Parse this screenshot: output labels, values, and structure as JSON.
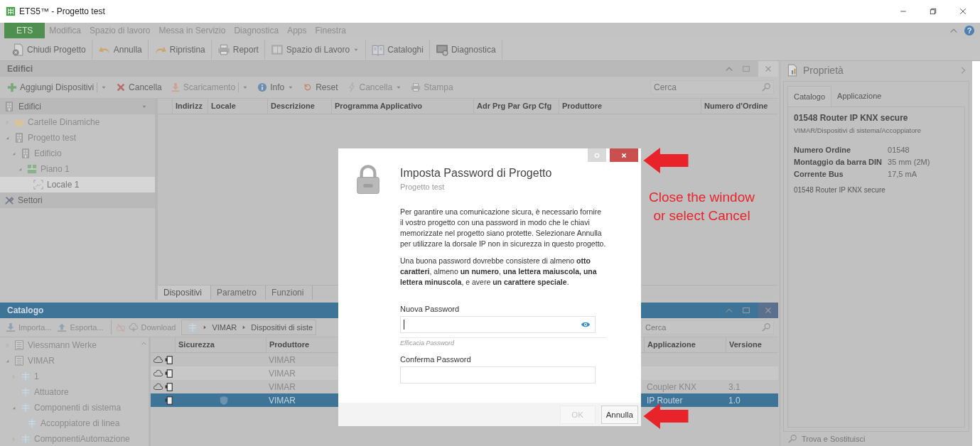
{
  "window": {
    "title": "ETS5™ - Progetto test"
  },
  "menu": [
    {
      "label": "ETS",
      "selected": true
    },
    {
      "label": "Modifica",
      "selected": false
    },
    {
      "label": "Spazio di lavoro",
      "selected": false
    },
    {
      "label": "Messa in Servizio",
      "selected": false
    },
    {
      "label": "Diagnostica",
      "selected": false
    },
    {
      "label": "Apps",
      "selected": false
    },
    {
      "label": "Finestra",
      "selected": false
    }
  ],
  "help": "?",
  "toolbar": [
    {
      "label": "Chiudi Progetto",
      "dropdown": false
    },
    {
      "label": "Annulla",
      "dropdown": false
    },
    {
      "label": "Ripristina",
      "dropdown": false
    },
    {
      "label": "Report",
      "dropdown": false
    },
    {
      "label": "Spazio di Lavoro",
      "dropdown": true
    },
    {
      "label": "Cataloghi",
      "dropdown": false
    },
    {
      "label": "Diagnostica",
      "dropdown": false
    }
  ],
  "buildings_panel": {
    "title": "Edifici",
    "toolbar": [
      {
        "label": "Aggiungi Dispositivi",
        "dropdown": true,
        "split": true,
        "disabled": false
      },
      {
        "label": "Cancella",
        "dropdown": false,
        "split": false,
        "disabled": false
      },
      {
        "label": "Scaricamento",
        "dropdown": true,
        "split": true,
        "disabled": true
      },
      {
        "label": "Info",
        "dropdown": true,
        "split": false,
        "disabled": false
      },
      {
        "label": "Reset",
        "dropdown": false,
        "split": false,
        "disabled": false
      },
      {
        "label": "Cancella",
        "dropdown": true,
        "split": false,
        "disabled": true
      },
      {
        "label": "Stampa",
        "dropdown": false,
        "split": false,
        "disabled": true
      }
    ],
    "search": {
      "placeholder": "Cerca"
    },
    "tree": {
      "title": "Edifici",
      "items": [
        {
          "label": "Cartelle Dinamiche",
          "expanded": false,
          "selected": false
        },
        {
          "label": "Progetto test",
          "expanded": true,
          "selected": false,
          "children": [
            {
              "label": "Edificio",
              "expanded": true,
              "selected": false,
              "children": [
                {
                  "label": "Piano 1",
                  "expanded": true,
                  "selected": false,
                  "children": [
                    {
                      "label": "Locale 1",
                      "selected": true
                    }
                  ]
                }
              ]
            }
          ]
        }
      ]
    },
    "sectors": {
      "label": "Settori"
    },
    "table": {
      "columns": [
        "Indirizz",
        "Locale",
        "Descrizione",
        "Programma Applicativo",
        "Adr Prg Par Grp Cfg",
        "Produttore",
        "Numero d'Ordine"
      ]
    },
    "tabs": [
      {
        "label": "Dispositivi",
        "selected": true
      },
      {
        "label": "Parametro",
        "selected": false
      },
      {
        "label": "Funzioni",
        "selected": false
      }
    ]
  },
  "catalog_panel": {
    "title": "Catalogo",
    "toolbar": [
      {
        "label": "Importa...",
        "disabled": true
      },
      {
        "label": "Esporta...",
        "disabled": true
      },
      {
        "label": "Download",
        "disabled": true
      }
    ],
    "breadcrumb": [
      "VIMAR",
      "Dispositivi di siste"
    ],
    "search": {
      "placeholder": "Cerca"
    },
    "tree": {
      "items": [
        {
          "label": "Viessmann Werke",
          "expanded": false
        },
        {
          "label": "VIMAR",
          "expanded": true,
          "children": [
            {
              "label": "1",
              "expanded": false
            },
            {
              "label": "Attuatore"
            },
            {
              "label": "Componenti di sistema",
              "expanded": true,
              "children": [
                {
                  "label": "Accoppiatore di linea"
                }
              ]
            },
            {
              "label": "ComponentiAutomazione",
              "expanded": false
            }
          ]
        }
      ]
    },
    "table": {
      "columns": [
        "Sicurezza",
        "Produttore",
        "Applicazione",
        "Versione"
      ],
      "rows": [
        {
          "secure": false,
          "selected": false,
          "manufacturer": "VIMAR"
        },
        {
          "secure": false,
          "selected": false,
          "manufacturer": "VIMAR"
        },
        {
          "secure": false,
          "selected": false,
          "manufacturer": "VIMAR",
          "application": "Coupler KNX",
          "version": "3.1"
        },
        {
          "secure": true,
          "selected": true,
          "manufacturer": "VIMAR",
          "application": "IP Router",
          "version": "1.0"
        }
      ]
    }
  },
  "properties": {
    "title": "Proprietà",
    "tabs": [
      {
        "label": "Catalogo",
        "selected": true
      },
      {
        "label": "Applicazione",
        "selected": false
      }
    ],
    "product": "01548 Router IP KNX secure",
    "path": "VIMAR/Dispositivi di sistema/Accoppiatore",
    "rows": [
      {
        "name": "Numero Ordine",
        "value": "01548"
      },
      {
        "name": "Montaggio da barra DIN",
        "value": "35 mm (2M)"
      },
      {
        "name": "Corrente Bus",
        "value": "17,5 mA"
      }
    ],
    "description": "01548 Router IP KNX secure",
    "footer": "Trova e Sostituisci"
  },
  "dialog": {
    "title": "Imposta Password di Progetto",
    "subtitle": "Progetto test",
    "paragraphs": [
      "Per garantire una comunicazione sicura, è necessario fornire il vostro progetto con una password in modo che le chiavi memorizzate nel progetto siano protette. Selezionare Annulla per utilizzare la dorsale IP non in sicurezza in questo progetto.",
      "Una buona password dovrebbe consistere di almeno **otto caratteri**, almeno **un numero**, **una lettera maiuscola, una lettera minuscola**, e avere **un carattere speciale**."
    ],
    "new_password": {
      "label": "Nuova Password",
      "focused": true,
      "hint": "Efficacia Password"
    },
    "confirm_password": {
      "label": "Conferma Password",
      "focused": false
    },
    "buttons": [
      {
        "label": "OK",
        "disabled": true
      },
      {
        "label": "Annulla",
        "disabled": false
      }
    ]
  },
  "annotation": {
    "text": "Close the window or select Cancel"
  }
}
